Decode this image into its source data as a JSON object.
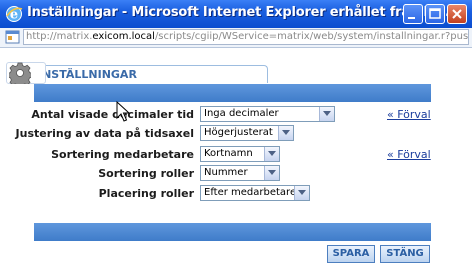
{
  "window": {
    "title": "Inställningar - Microsoft Internet Explorer erhållet från Ex...",
    "icon": "ie-icon",
    "controls": [
      "minimize",
      "maximize",
      "close"
    ]
  },
  "address": {
    "prefix": "http://matrix.",
    "host": "exicom.local",
    "path": "/scripts/cgiip/WService=matrix/web/system/installningar.r?pusrR"
  },
  "tab": {
    "label": "INSTÄLLNINGAR",
    "icon": "gear-icon"
  },
  "settings": [
    {
      "label": "Antal visade decimaler tid",
      "value": "Inga decimaler",
      "reset": "« Förval"
    },
    {
      "label": "Justering av data på tidsaxel",
      "value": "Högerjusterat",
      "reset": ""
    },
    {
      "label": "Sortering medarbetare",
      "value": "Kortnamn",
      "reset": "« Förval"
    },
    {
      "label": "Sortering roller",
      "value": "Nummer",
      "reset": ""
    },
    {
      "label": "Placering roller",
      "value": "Efter medarbetare",
      "reset": ""
    }
  ],
  "buttons": {
    "save": "SPARA",
    "close": "STÄNG"
  },
  "colors": {
    "titlebar": "#0a4ccf",
    "panel_bar": "#4f8ad4",
    "link": "#1a3c9c",
    "button_text": "#2b5fa3"
  }
}
